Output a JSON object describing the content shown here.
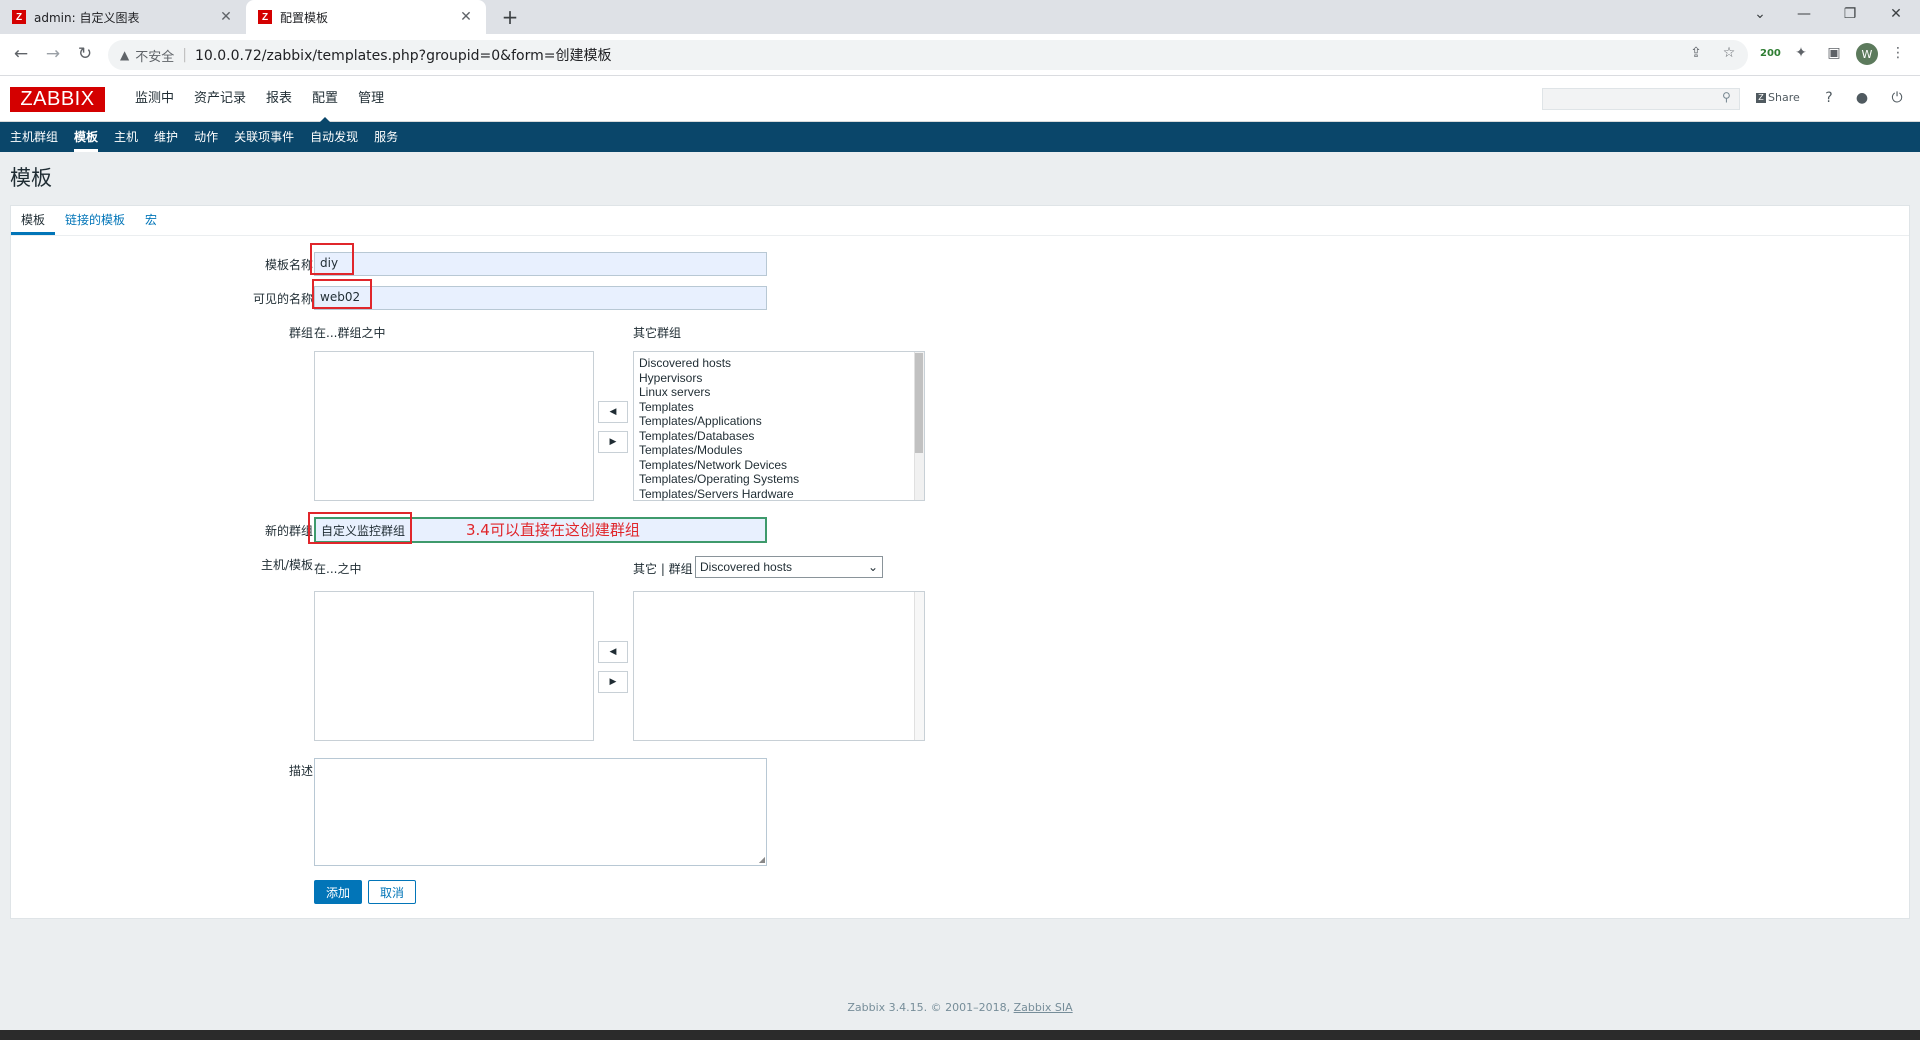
{
  "browser": {
    "tabs": [
      {
        "title": "admin: 自定义图表",
        "favicon": "Z"
      },
      {
        "title": "配置模板",
        "favicon": "Z"
      }
    ],
    "url_security": "不安全",
    "url": "10.0.0.72/zabbix/templates.php?groupid=0&form=创建模板",
    "ext_badge": "200",
    "profile_initial": "W"
  },
  "header": {
    "logo": "ZABBIX",
    "menu": [
      "监测中",
      "资产记录",
      "报表",
      "配置",
      "管理"
    ],
    "share_label": "Share"
  },
  "sub_nav": [
    "主机群组",
    "模板",
    "主机",
    "维护",
    "动作",
    "关联项事件",
    "自动发现",
    "服务"
  ],
  "page_title": "模板",
  "form_tabs": [
    "模板",
    "链接的模板",
    "宏"
  ],
  "form": {
    "template_name_label": "模板名称",
    "template_name_value": "diy",
    "visible_name_label": "可见的名称",
    "visible_name_value": "web02",
    "groups_label": "群组",
    "in_groups_label": "在...群组之中",
    "other_groups_label": "其它群组",
    "other_groups": [
      "Discovered hosts",
      "Hypervisors",
      "Linux servers",
      "Templates",
      "Templates/Applications",
      "Templates/Databases",
      "Templates/Modules",
      "Templates/Network Devices",
      "Templates/Operating Systems",
      "Templates/Servers Hardware"
    ],
    "new_group_label": "新的群组",
    "new_group_value": "自定义监控群组",
    "annotation": "3.4可以直接在这创建群组",
    "hosts_label": "主机/模板",
    "in_hosts_label": "在...之中",
    "other_hosts_label": "其它 | 群组",
    "other_hosts_select": "Discovered hosts",
    "description_label": "描述",
    "add_button": "添加",
    "cancel_button": "取消"
  },
  "footer": {
    "text": "Zabbix 3.4.15. © 2001–2018,",
    "link": "Zabbix SIA"
  },
  "colors": {
    "brand_red": "#d40000",
    "nav_blue": "#0a466a",
    "link_blue": "#0275b8",
    "annotation_red": "#e0262b"
  }
}
